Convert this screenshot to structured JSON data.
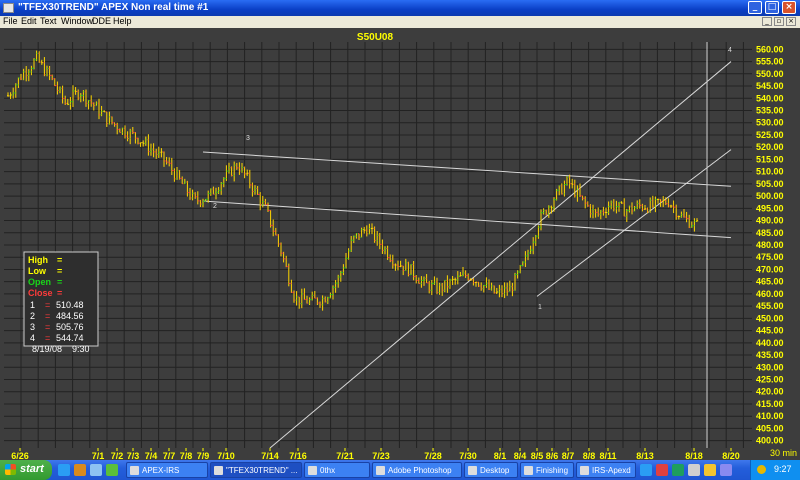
{
  "window": {
    "title": "\"TFEX30TREND\" APEX Non real time #1"
  },
  "menu": [
    "File",
    "Edit",
    "Text",
    "Window",
    "DDE",
    "Help"
  ],
  "chart": {
    "symbol": "S50U08",
    "colors": {
      "background": "#3d3d3d",
      "grid": "#222222",
      "axis_text": "#ffff00",
      "bar_up": "#19d419",
      "bar_down": "#ff3b3b",
      "bar_neutral": "#ffd700",
      "trendline": "#d8d8d8"
    },
    "y_ticks": [
      400,
      405,
      410,
      415,
      420,
      425,
      430,
      435,
      440,
      445,
      450,
      455,
      460,
      465,
      470,
      475,
      480,
      485,
      490,
      495,
      500,
      505,
      510,
      515,
      520,
      525,
      530,
      535,
      540,
      545,
      550,
      555,
      560
    ],
    "x_ticks": [
      "6/26",
      "7/1",
      "7/2",
      "7/3",
      "7/4",
      "7/7",
      "7/8",
      "7/9",
      "7/10",
      "7/14",
      "7/16",
      "7/21",
      "7/23",
      "7/28",
      "7/30",
      "8/1",
      "8/4",
      "8/5",
      "8/6",
      "8/7",
      "8/8",
      "8/11",
      "8/13",
      "8/18",
      "8/20"
    ],
    "timeframe": "30 min",
    "point_markers": [
      "1",
      "2",
      "3",
      "4"
    ],
    "info_box": {
      "labels": [
        {
          "text": "High",
          "sep": "=",
          "color": "#ffff00"
        },
        {
          "text": "Low",
          "sep": "=",
          "color": "#ffff00"
        },
        {
          "text": "Open",
          "sep": "=",
          "color": "#19d419"
        },
        {
          "text": "Close",
          "sep": "=",
          "color": "#ff3b3b"
        }
      ],
      "points": [
        {
          "n": "1",
          "sep": "=",
          "value": "510.48"
        },
        {
          "n": "2",
          "sep": "=",
          "value": "484.56"
        },
        {
          "n": "3",
          "sep": "=",
          "value": "505.76"
        },
        {
          "n": "4",
          "sep": "=",
          "value": "544.74"
        }
      ],
      "date": "8/19/08",
      "time": "9:30"
    }
  },
  "chart_data": {
    "type": "candlestick",
    "title": "S50U08",
    "ylim": [
      397,
      563
    ],
    "x_categories": [
      "6/26",
      "7/1",
      "7/2",
      "7/3",
      "7/4",
      "7/7",
      "7/8",
      "7/9",
      "7/10",
      "7/14",
      "7/16",
      "7/21",
      "7/23",
      "7/28",
      "7/30",
      "8/1",
      "8/4",
      "8/5",
      "8/6",
      "8/7",
      "8/8",
      "8/11",
      "8/13",
      "8/18",
      "8/20"
    ],
    "price_path_keyframes": [
      541,
      550,
      556,
      548,
      538,
      543,
      537,
      531,
      527,
      524,
      519,
      514,
      506,
      498,
      500,
      507,
      513,
      504,
      494,
      478,
      458,
      457,
      458,
      466,
      482,
      487,
      480,
      473,
      470,
      464,
      462,
      465,
      468,
      464,
      460,
      462,
      473,
      490,
      499,
      506,
      498,
      492,
      497,
      494,
      496,
      496,
      498,
      491,
      488
    ],
    "trendlines": [
      {
        "from": "7/14",
        "y_from": 397,
        "to": "8/20",
        "y_to": 555
      },
      {
        "from": "8/5",
        "y_from": 459,
        "to": "8/20",
        "y_to": 519
      },
      {
        "from": "7/9",
        "y_from": 518,
        "to": "8/20",
        "y_to": 504
      },
      {
        "from": "7/9",
        "y_from": 498,
        "to": "8/20",
        "y_to": 483
      }
    ]
  },
  "taskbar": {
    "start": "start",
    "tasks": [
      "APEX-IRS",
      "\"TFEX30TREND\" ...",
      "0thx",
      "Adobe Photoshop",
      "Desktop",
      "Finishing",
      "IRS-Apexd"
    ],
    "clock": "9:27"
  }
}
